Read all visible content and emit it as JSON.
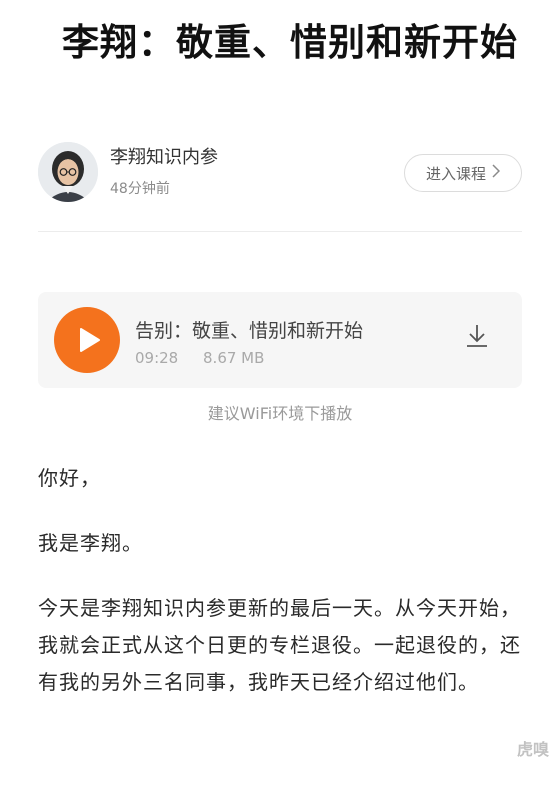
{
  "article": {
    "title": "李翔：敬重、惜别和新开始"
  },
  "author": {
    "name": "李翔知识内参",
    "time": "48分钟前",
    "course_button": "进入课程"
  },
  "audio": {
    "title": "告别：敬重、惜别和新开始",
    "duration": "09:28",
    "size": "8.67 MB",
    "hint": "建议WiFi环境下播放",
    "accent_color": "#f4721d"
  },
  "body": {
    "paragraphs": [
      "你好，",
      "我是李翔。",
      "今天是李翔知识内参更新的最后一天。从今天开始，我就会正式从这个日更的专栏退役。一起退役的，还有我的另外三名同事，我昨天已经介绍过他们。"
    ]
  },
  "watermark": "虎嗅",
  "icons": {
    "avatar": "person-avatar",
    "play": "play-icon",
    "download": "download-icon",
    "chevron": "chevron-right-icon"
  }
}
